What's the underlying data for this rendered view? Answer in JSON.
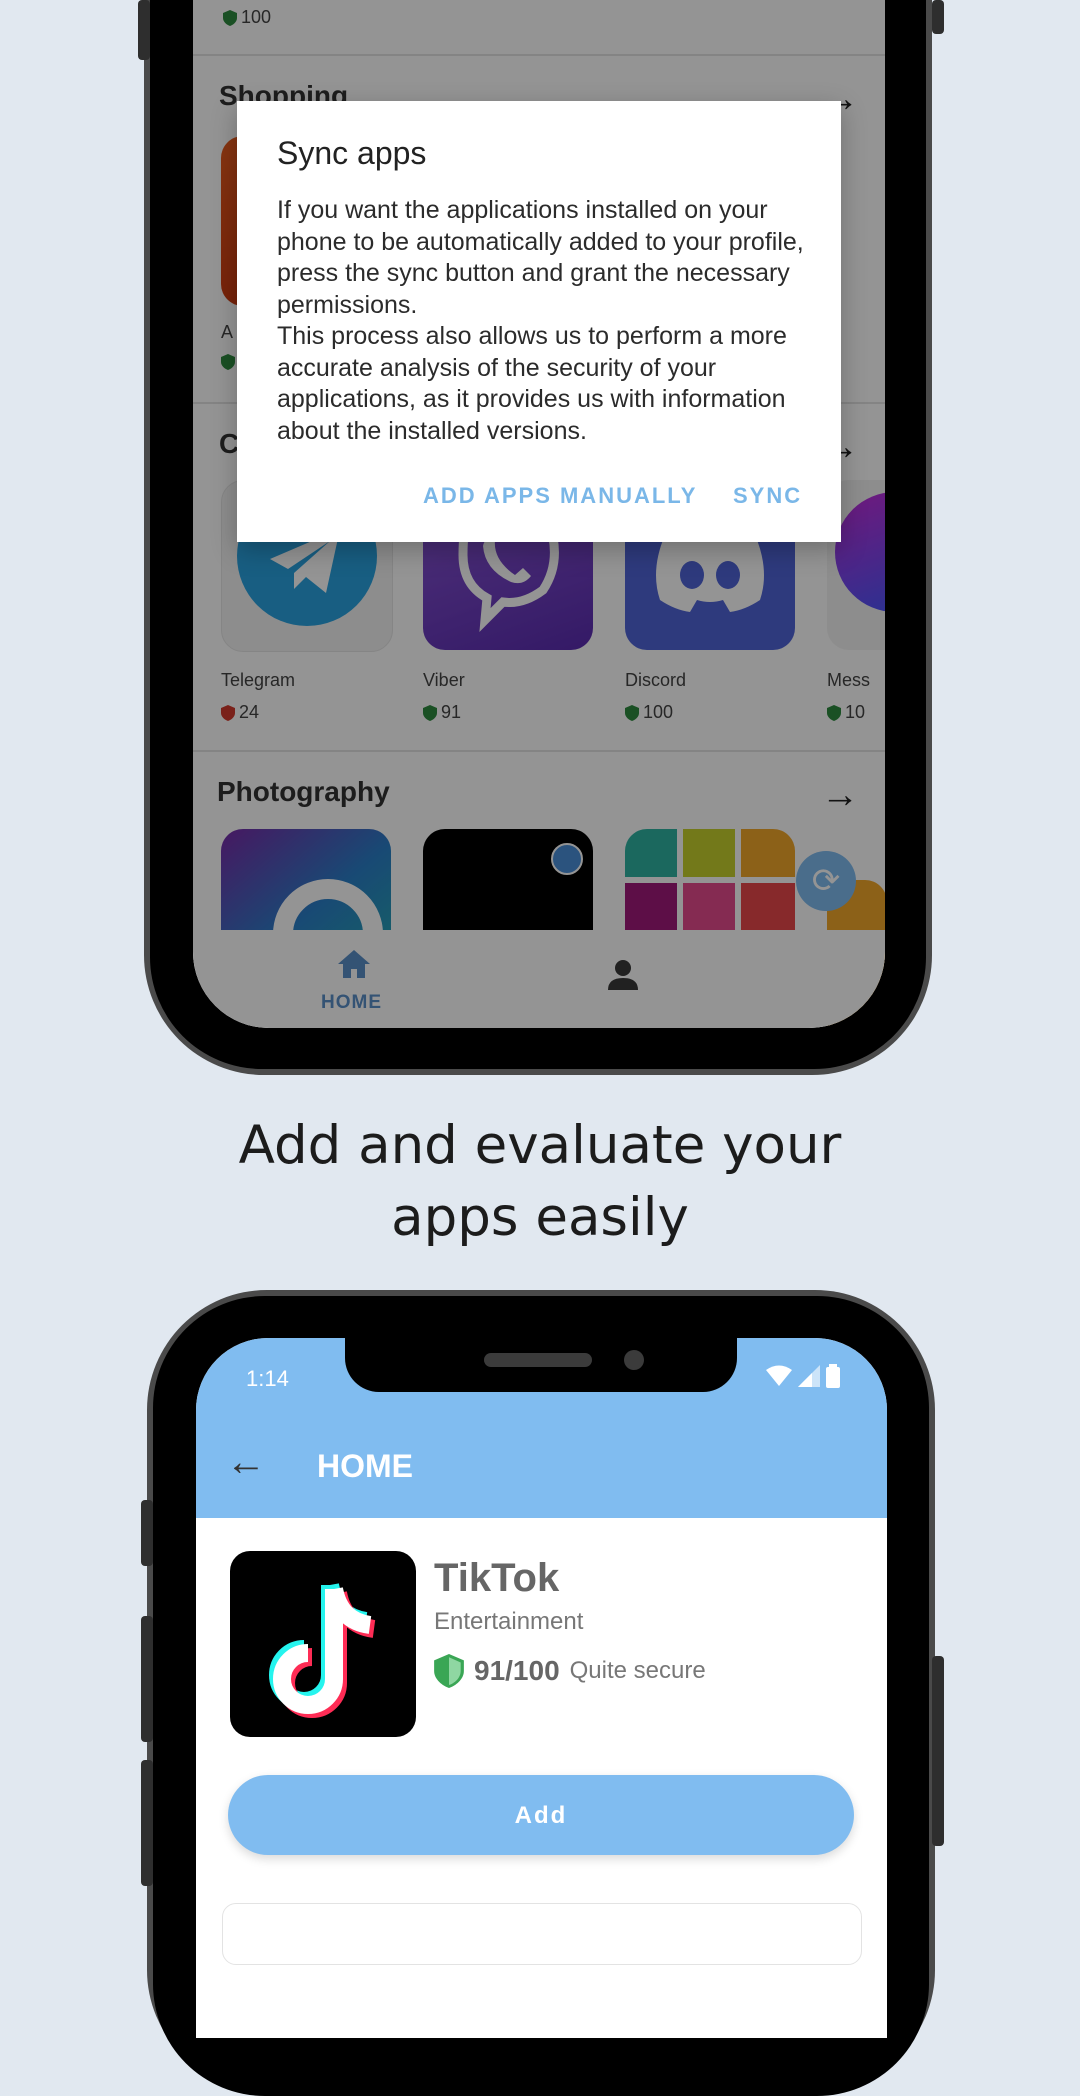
{
  "top_screen": {
    "first_row_score": "100",
    "sections": [
      {
        "title": "Shopping"
      },
      {
        "title": "Communication",
        "visible_fragment": "C"
      },
      {
        "title": "Photography"
      }
    ],
    "communication_apps": [
      {
        "name": "Telegram",
        "score": "24",
        "shield": "red"
      },
      {
        "name": "Viber",
        "score": "91",
        "shield": "green"
      },
      {
        "name": "Discord",
        "score": "100",
        "shield": "green"
      },
      {
        "name": "Mess",
        "score": "10",
        "shield": "green"
      }
    ],
    "shopping_fragment_label": "A",
    "bottom_nav": {
      "home_label": "HOME"
    },
    "dialog": {
      "title": "Sync apps",
      "body": "If you want the applications installed on your phone to be automatically added to your profile, press the sync button and grant the necessary permissions.\nThis process also allows us to perform a more accurate analysis of the security of your applications, as it provides us with information about the installed versions.",
      "button_manual": "ADD APPS MANUALLY",
      "button_sync": "SYNC"
    }
  },
  "caption": "Add and evaluate your apps easily",
  "bottom_screen": {
    "status_time": "1:14",
    "appbar_title": "HOME",
    "app": {
      "name": "TikTok",
      "category": "Entertainment",
      "score": "91/100",
      "score_label": "Quite secure"
    },
    "add_button": "Add"
  },
  "colors": {
    "accent": "#80bcf0",
    "dialog_button": "#7ab7e8",
    "background": "#e1e8f0"
  }
}
